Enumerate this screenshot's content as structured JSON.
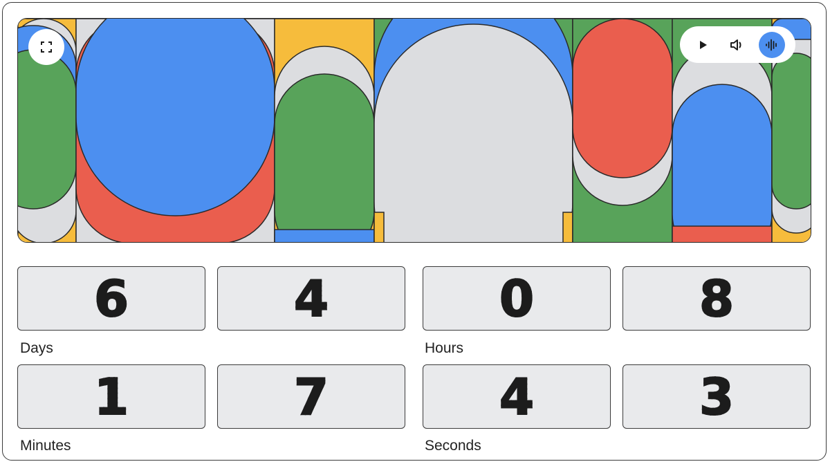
{
  "controls": {
    "fullscreen_icon": "fullscreen-icon",
    "play_icon": "play-icon",
    "volume_icon": "volume-icon",
    "audio_wave_icon": "audio-wave-icon"
  },
  "countdown": {
    "days": {
      "label": "Days",
      "digits": [
        "6",
        "4"
      ]
    },
    "hours": {
      "label": "Hours",
      "digits": [
        "0",
        "8"
      ]
    },
    "minutes": {
      "label": "Minutes",
      "digits": [
        "1",
        "7"
      ]
    },
    "seconds": {
      "label": "Seconds",
      "digits": [
        "4",
        "3"
      ]
    }
  },
  "colors": {
    "blue": "#4c8ff0",
    "red": "#ea5e4e",
    "green": "#58a35a",
    "yellow": "#f6bc3c",
    "gray": "#dcdde0"
  }
}
